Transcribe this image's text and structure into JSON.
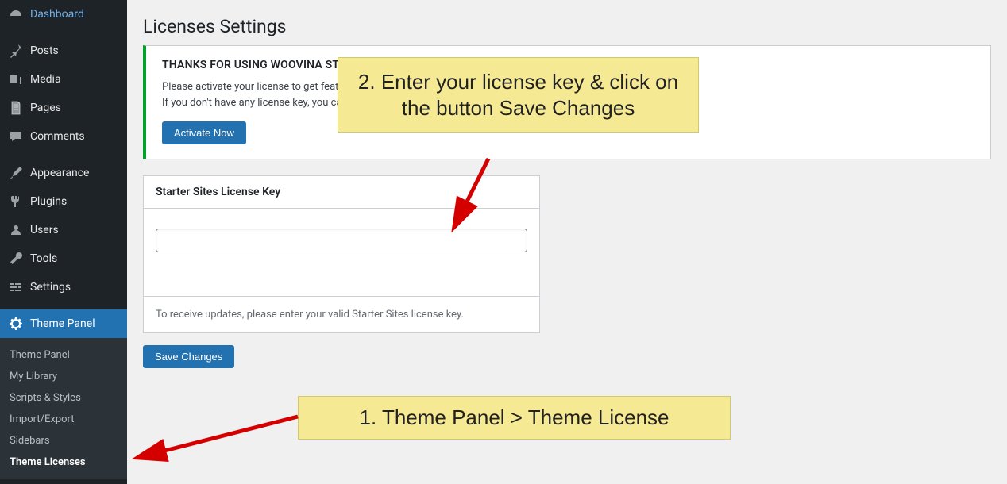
{
  "sidebar": {
    "menu": [
      {
        "label": "Dashboard"
      },
      {
        "label": "Posts"
      },
      {
        "label": "Media"
      },
      {
        "label": "Pages"
      },
      {
        "label": "Comments"
      },
      {
        "label": "Appearance"
      },
      {
        "label": "Plugins"
      },
      {
        "label": "Users"
      },
      {
        "label": "Tools"
      },
      {
        "label": "Settings"
      },
      {
        "label": "Theme Panel"
      }
    ],
    "submenu": [
      {
        "label": "Theme Panel"
      },
      {
        "label": "My Library"
      },
      {
        "label": "Scripts & Styles"
      },
      {
        "label": "Import/Export"
      },
      {
        "label": "Sidebars"
      },
      {
        "label": "Theme Licenses"
      }
    ]
  },
  "page": {
    "title": "Licenses Settings"
  },
  "notice": {
    "heading": "THANKS FOR USING WOOVINA STARTER SITES",
    "line1": "Please activate your license to get feature updates, premium support and unlimited access to the starter sites library.",
    "line2": "If you don't have any license key, you can get it here!",
    "button": "Activate Now"
  },
  "panel": {
    "heading": "Starter Sites License Key",
    "value": "",
    "footer": "To receive updates, please enter your valid Starter Sites license key."
  },
  "buttons": {
    "save": "Save Changes"
  },
  "annotations": {
    "step1": "1. Theme Panel > Theme License",
    "step2": "2. Enter your license key & click on the button Save Changes"
  }
}
